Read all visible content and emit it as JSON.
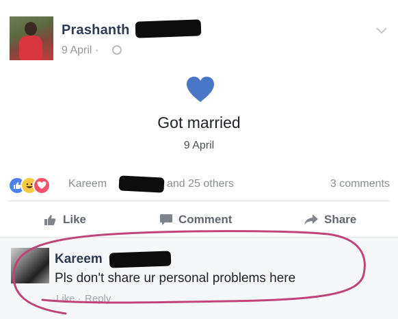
{
  "post": {
    "author_name": "Prashanth",
    "date": "9 April",
    "date_sep": "·"
  },
  "life_event": {
    "title": "Got married",
    "date": "9 April",
    "heart_color": "#4a76c6"
  },
  "reactions": {
    "names": "Kareem",
    "others": "and 25 others",
    "comment_count": "3 comments"
  },
  "actions": {
    "like_label": "Like",
    "comment_label": "Comment",
    "share_label": "Share"
  },
  "comment": {
    "author_name": "Kareem",
    "text": "Pls don't share ur personal problems here",
    "like_label": "Like",
    "separator": "·",
    "reply_label": "Reply"
  },
  "colors": {
    "brand_name": "#2d3a55",
    "annotation_circle": "#c0447a"
  }
}
